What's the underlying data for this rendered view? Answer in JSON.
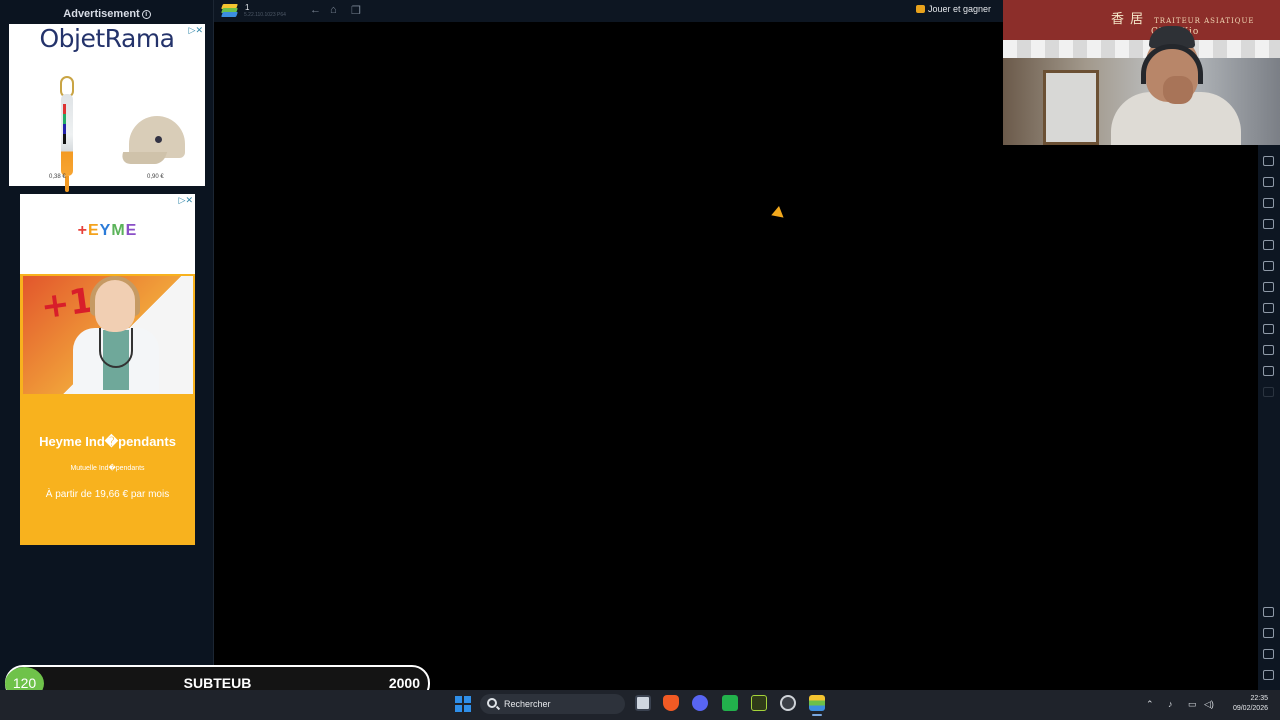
{
  "ads": {
    "header": "Advertisement",
    "ad1": {
      "brand": "ObjetRama",
      "prices": [
        "0,38 €",
        "0,90 €"
      ]
    },
    "ad2": {
      "logo": [
        "+",
        "E",
        "Y",
        "M",
        "E",
        ""
      ],
      "badge": "+1",
      "title": "Heyme Ind�pendants",
      "subtitle": "Mutuelle Ind�pendants",
      "promo": "À partir de 19,66 € par mois"
    }
  },
  "emulator": {
    "tab_number": "1",
    "version": "5.22.110.1023  P64",
    "promo_label": "Jouer et gagner"
  },
  "webcam": {
    "sign_text": "TRAITEUR ASIATIQUE",
    "sign_chars": "香 居",
    "sign_sub": "Chez Xio"
  },
  "subathon": {
    "count": "120",
    "label": "SUBTEUB",
    "goal": "2000"
  },
  "taskbar": {
    "search_placeholder": "Rechercher",
    "time": "22:35",
    "date": "09/02/2026"
  },
  "colors": {
    "accent_cursor": "#f2a81d",
    "sub_circle": "#6fc24a",
    "ad_yellow": "#f8b21e"
  }
}
